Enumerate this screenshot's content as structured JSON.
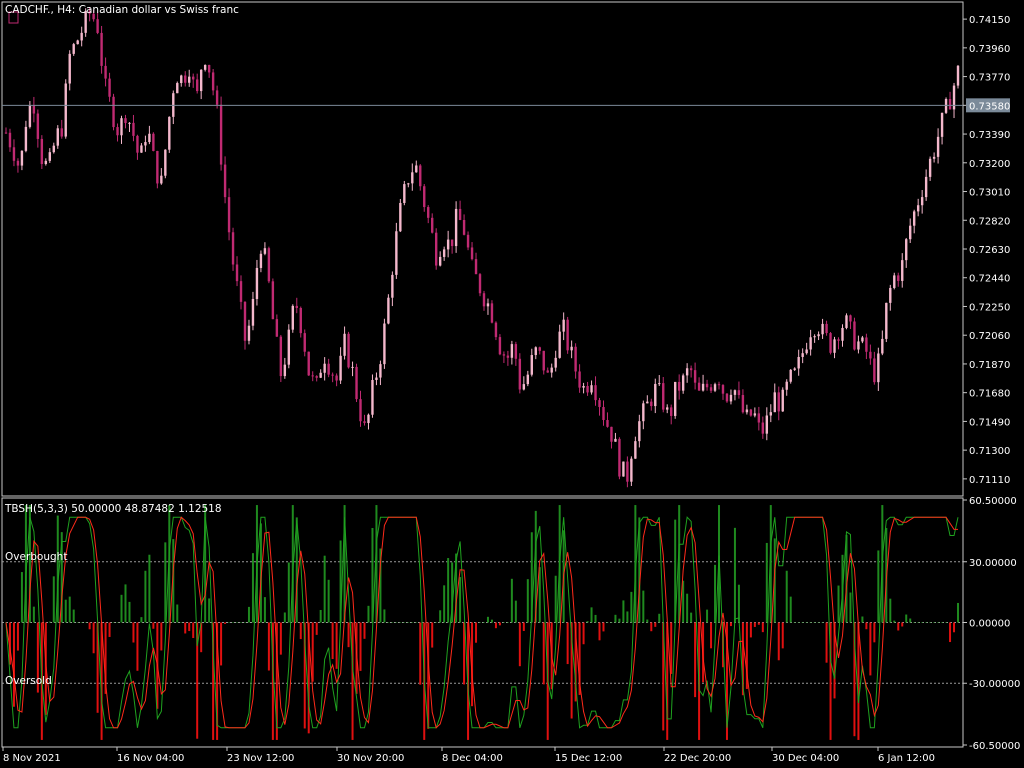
{
  "colors": {
    "background": "#000000",
    "frame": "#c8c8c8",
    "axis_text": "#ffffff",
    "bull_candle": "#f4b8cc",
    "bear_candle": "#c02a72",
    "price_line": "#7b8a99",
    "price_label_bg": "#7b8a99",
    "histogram_up": "#1f8a1f",
    "histogram_down": "#e01010",
    "signal_green": "#1fa21f",
    "signal_red": "#ff2a1a",
    "level_line": "#9a9a9a"
  },
  "header": {
    "symbol_line": "CADCHF., H4:  Canadian dollar vs Swiss franc"
  },
  "indicator": {
    "label": "TBSH(5,3,3) 50.00000 48.87482 1.12518",
    "overbought_label": "Overbought",
    "oversold_label": "Oversold"
  },
  "chart_data": [
    {
      "type": "candlestick",
      "title": "CADCHF., H4:  Canadian dollar vs Swiss franc",
      "ylim": [
        0.7101,
        0.7425
      ],
      "y_ticks": [
        0.7415,
        0.7396,
        0.7377,
        0.7358,
        0.7339,
        0.732,
        0.7301,
        0.7282,
        0.7263,
        0.7244,
        0.7225,
        0.7206,
        0.7187,
        0.7168,
        0.7149,
        0.713,
        0.7111
      ],
      "y_tick_labels": [
        "0.74150",
        "0.73960",
        "0.73770",
        "0.73580",
        "0.73390",
        "0.73200",
        "0.73010",
        "0.72820",
        "0.72630",
        "0.72440",
        "0.72250",
        "0.72060",
        "0.71870",
        "0.71680",
        "0.71490",
        "0.71300",
        "0.71110"
      ],
      "current_price": 0.7358,
      "current_price_label": "0.73580",
      "x_tick_labels": [
        "8 Nov 2021",
        "16 Nov 04:00",
        "23 Nov 12:00",
        "30 Nov 20:00",
        "8 Dec 04:00",
        "15 Dec 12:00",
        "22 Dec 20:00",
        "30 Dec 04:00",
        "6 Jan 12:00"
      ],
      "close_path": [
        0.734,
        0.733,
        0.7315,
        0.7355,
        0.736,
        0.7325,
        0.7315,
        0.7335,
        0.7345,
        0.739,
        0.74,
        0.741,
        0.742,
        0.741,
        0.737,
        0.7355,
        0.734,
        0.7355,
        0.734,
        0.732,
        0.7345,
        0.732,
        0.7305,
        0.7345,
        0.738,
        0.7375,
        0.7385,
        0.736,
        0.7395,
        0.738,
        0.735,
        0.73,
        0.726,
        0.723,
        0.72,
        0.7225,
        0.727,
        0.725,
        0.721,
        0.718,
        0.72,
        0.723,
        0.721,
        0.718,
        0.717,
        0.7195,
        0.7185,
        0.7175,
        0.72,
        0.7185,
        0.716,
        0.714,
        0.717,
        0.719,
        0.722,
        0.726,
        0.729,
        0.731,
        0.732,
        0.73,
        0.728,
        0.726,
        0.727,
        0.7265,
        0.7285,
        0.7275,
        0.725,
        0.724,
        0.723,
        0.722,
        0.72,
        0.719,
        0.72,
        0.717,
        0.718,
        0.7195,
        0.719,
        0.7175,
        0.72,
        0.721,
        0.7195,
        0.718,
        0.717,
        0.718,
        0.7165,
        0.715,
        0.714,
        0.712,
        0.711,
        0.714,
        0.715,
        0.716,
        0.717,
        0.7165,
        0.715,
        0.717,
        0.7175,
        0.7185,
        0.7165,
        0.717,
        0.7175,
        0.718,
        0.7165,
        0.7175,
        0.716,
        0.715,
        0.7155,
        0.714,
        0.715,
        0.7165,
        0.716,
        0.7175,
        0.718,
        0.7195,
        0.721,
        0.7215,
        0.7205,
        0.72,
        0.721,
        0.7215,
        0.7205,
        0.72,
        0.7195,
        0.718,
        0.719,
        0.723,
        0.7245,
        0.725,
        0.7275,
        0.729,
        0.7305,
        0.732,
        0.7335,
        0.735,
        0.7365,
        0.738
      ]
    },
    {
      "type": "oscillator",
      "title": "TBSH(5,3,3) 50.00000 48.87482 1.12518",
      "ylim": [
        -60.5,
        60.5
      ],
      "y_ticks": [
        60.5,
        30.0,
        0.0,
        -30.0,
        -60.5
      ],
      "y_tick_labels": [
        "60.50000",
        "30.00000",
        "0.00000",
        "-30.00000",
        "-60.50000"
      ],
      "levels": [
        30,
        0,
        -30
      ],
      "series": [
        {
          "kind": "histogram"
        },
        {
          "kind": "line",
          "color": "#1fa21f"
        },
        {
          "kind": "line",
          "color": "#ff2a1a"
        }
      ],
      "current_values": [
        50.0,
        48.87482,
        1.12518
      ]
    }
  ]
}
